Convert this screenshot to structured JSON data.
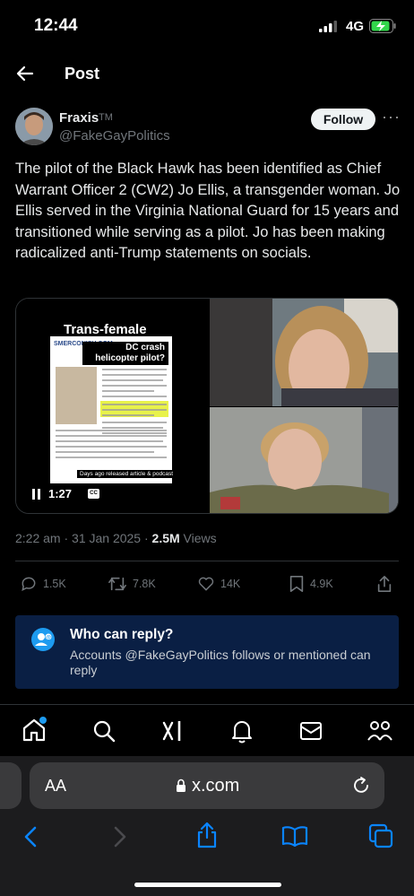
{
  "status": {
    "time": "12:44",
    "network": "4G"
  },
  "nav": {
    "title": "Post"
  },
  "author": {
    "name": "Fraxis",
    "tm": "TM",
    "handle": "@FakeGayPolitics",
    "follow_label": "Follow",
    "more": "···"
  },
  "post": {
    "text": "The pilot of the Black Hawk has been identified as Chief Warrant Officer 2 (CW2) Jo Ellis, a transgender woman. Jo Ellis served in the Virginia National Guard for 15 years and transitioned while serving as a pilot. Jo has been making radicalized anti-Trump statements on socials.",
    "media": {
      "video_title": "Trans-female",
      "source_label": "SMERCONISH.COM",
      "callout": "DC crash helicopter pilot?",
      "caption": "Days ago released article & podcast",
      "duration": "1:27",
      "cc": "CC"
    },
    "time": "2:22 am · 31 Jan 2025 · ",
    "views_count": "2.5M",
    "views_label": " Views"
  },
  "actions": {
    "replies": "1.5K",
    "reposts": "7.8K",
    "likes": "14K",
    "bookmarks": "4.9K"
  },
  "who_can_reply": {
    "title": "Who can reply?",
    "description": "Accounts @FakeGayPolitics follows or mentioned can reply"
  },
  "tabs": [
    "home",
    "search",
    "grok",
    "notifications",
    "messages",
    "communities"
  ],
  "safari": {
    "aa": "AA",
    "url": "x.com"
  },
  "colors": {
    "accent": "#1d9bf0",
    "reply_bg": "#0a1f44"
  }
}
